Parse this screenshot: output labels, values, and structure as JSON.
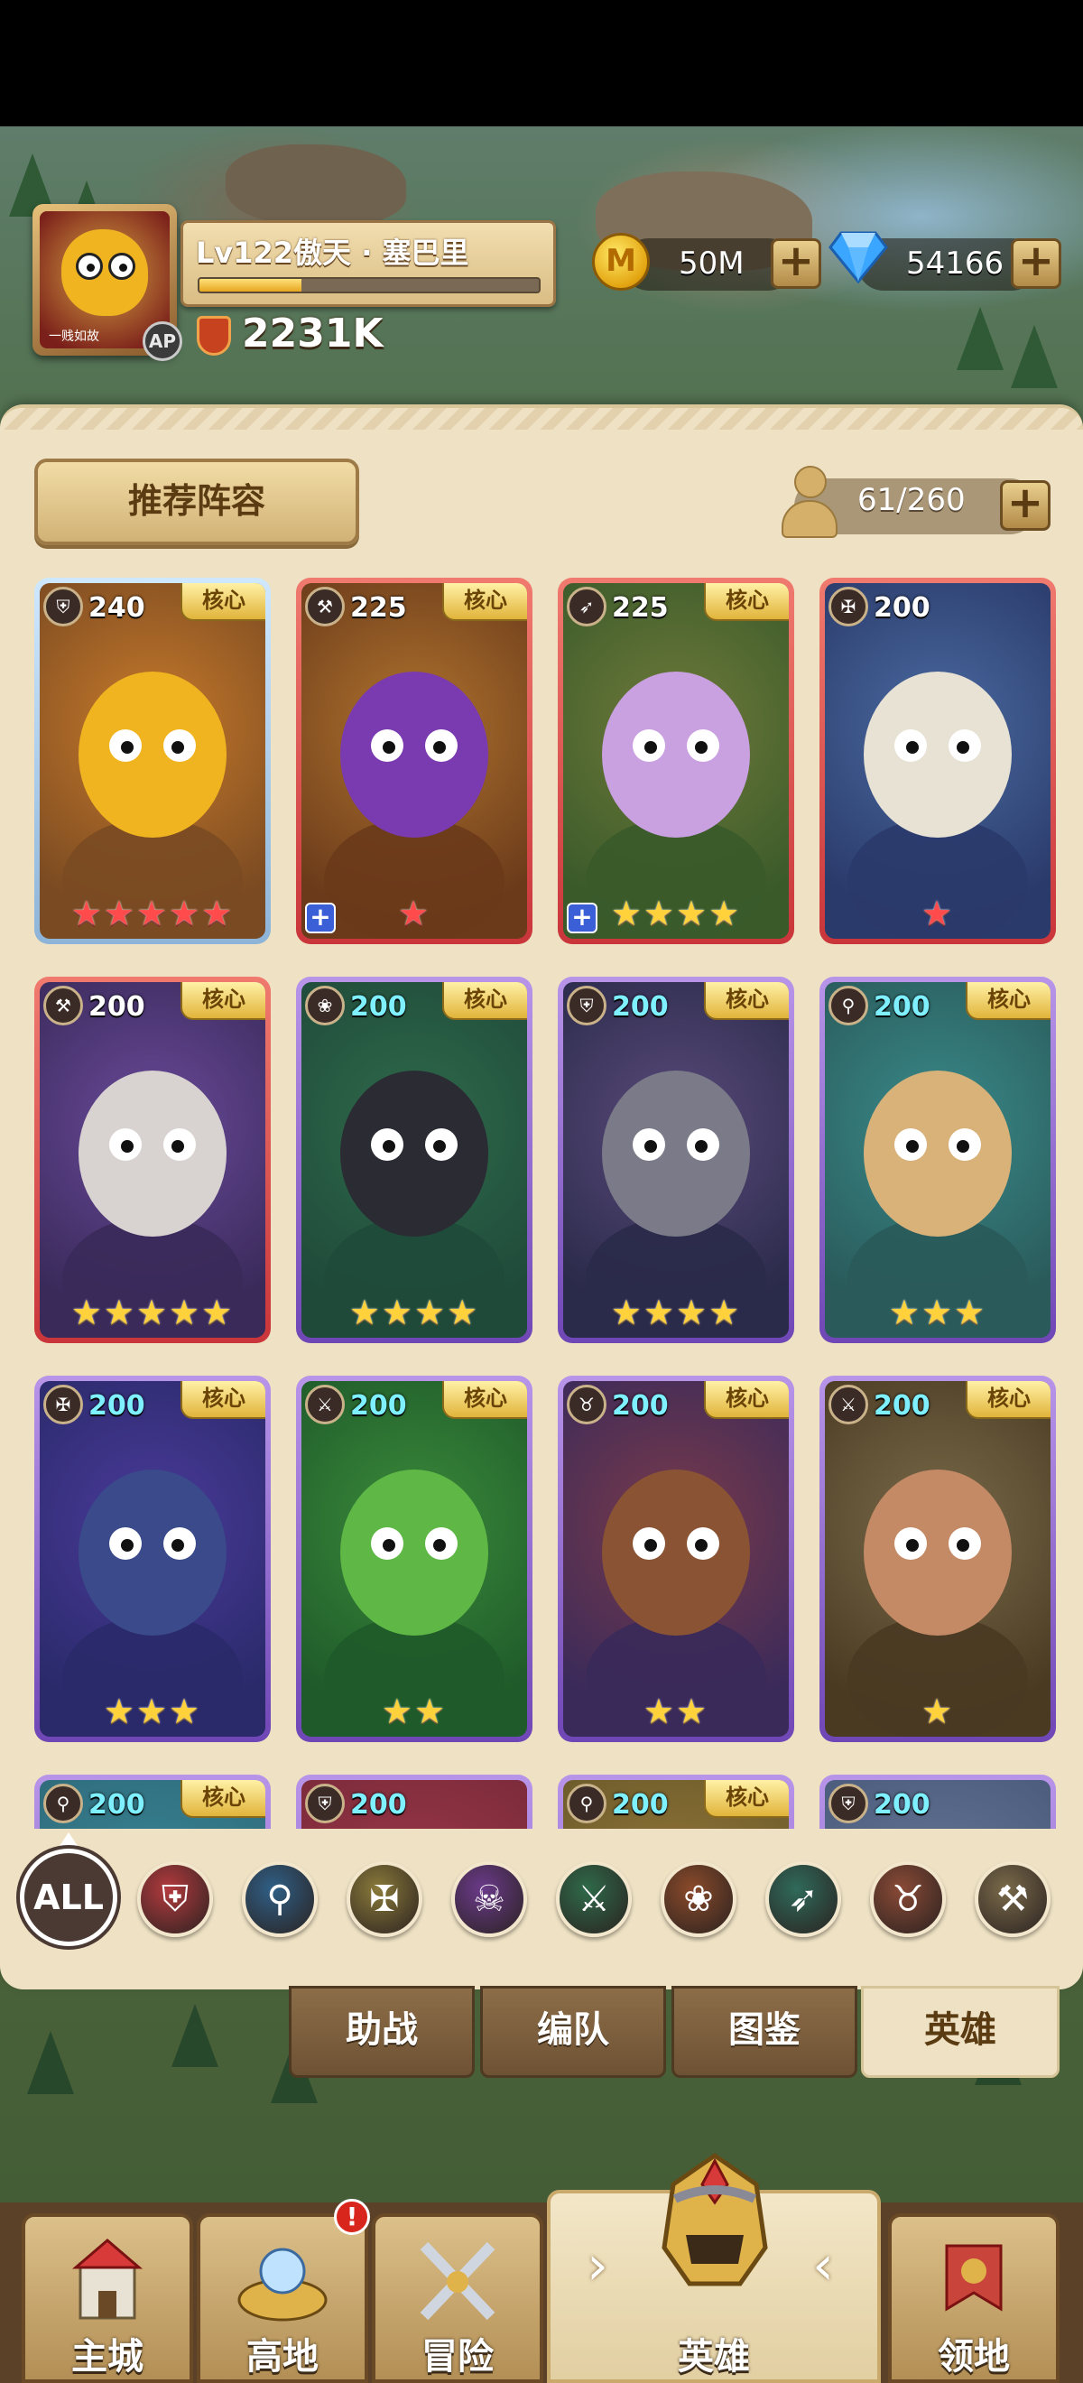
{
  "player": {
    "avatar_tag": "一贱如故",
    "badge": "AP",
    "name": "Lv122傲天 · 塞巴里",
    "xp_fraction": 0.3,
    "power": "2231K"
  },
  "currency": {
    "gold": "50M",
    "gold_coin_letter": "M",
    "gems": "54166",
    "plus": "+"
  },
  "panel": {
    "recommend_button": "推荐阵容",
    "capacity": "61/260",
    "capacity_plus": "+"
  },
  "heroes": [
    {
      "level": "240",
      "core": "核心",
      "frame": "blue",
      "class_icon": "shield-icon",
      "stars": 5,
      "star_color": "red",
      "plus": false,
      "level_color": "white",
      "portrait": "yellow-blob"
    },
    {
      "level": "225",
      "core": "核心",
      "frame": "red",
      "class_icon": "axe-icon",
      "stars": 1,
      "star_color": "red",
      "plus": true,
      "level_color": "white",
      "portrait": "elf-girl-brown"
    },
    {
      "level": "225",
      "core": "核心",
      "frame": "red",
      "class_icon": "bow-icon",
      "stars": 4,
      "star_color": "gold",
      "plus": true,
      "level_color": "white",
      "portrait": "elf-queen-green"
    },
    {
      "level": "200",
      "core": "",
      "frame": "red",
      "class_icon": "holy-icon",
      "stars": 1,
      "star_color": "red",
      "plus": false,
      "level_color": "white",
      "portrait": "blue-hair-girl"
    },
    {
      "level": "200",
      "core": "核心",
      "frame": "red",
      "class_icon": "hammer-icon",
      "stars": 5,
      "star_color": "gold",
      "plus": false,
      "level_color": "white",
      "portrait": "silver-hair-warrior"
    },
    {
      "level": "200",
      "core": "核心",
      "frame": "purple",
      "class_icon": "paw-icon",
      "stars": 4,
      "star_color": "gold",
      "plus": false,
      "level_color": "cyan",
      "portrait": "dark-dragon"
    },
    {
      "level": "200",
      "core": "核心",
      "frame": "purple",
      "class_icon": "shield-icon",
      "stars": 4,
      "star_color": "gold",
      "plus": false,
      "level_color": "cyan",
      "portrait": "horned-knight"
    },
    {
      "level": "200",
      "core": "核心",
      "frame": "purple",
      "class_icon": "staff-icon",
      "stars": 3,
      "star_color": "gold",
      "plus": false,
      "level_color": "cyan",
      "portrait": "elf-blonde"
    },
    {
      "level": "200",
      "core": "核心",
      "frame": "purple",
      "class_icon": "holy-icon",
      "stars": 3,
      "star_color": "gold",
      "plus": false,
      "level_color": "cyan",
      "portrait": "witch"
    },
    {
      "level": "200",
      "core": "核心",
      "frame": "purple",
      "class_icon": "blade-icon",
      "stars": 2,
      "star_color": "gold",
      "plus": false,
      "level_color": "cyan",
      "portrait": "green-orc"
    },
    {
      "level": "200",
      "core": "核心",
      "frame": "purple",
      "class_icon": "beast-icon",
      "stars": 2,
      "star_color": "gold",
      "plus": false,
      "level_color": "cyan",
      "portrait": "wolf-warrior"
    },
    {
      "level": "200",
      "core": "核心",
      "frame": "purple",
      "class_icon": "blade-icon",
      "stars": 1,
      "star_color": "gold",
      "plus": false,
      "level_color": "cyan",
      "portrait": "masked-assassin"
    },
    {
      "level": "200",
      "core": "核心",
      "frame": "purple",
      "class_icon": "staff-icon",
      "stars": 0,
      "star_color": "gold",
      "plus": false,
      "level_color": "cyan",
      "portrait": "teal"
    },
    {
      "level": "200",
      "core": "",
      "frame": "purple",
      "class_icon": "shield-icon",
      "stars": 0,
      "star_color": "gold",
      "plus": false,
      "level_color": "cyan",
      "portrait": "crimson"
    },
    {
      "level": "200",
      "core": "核心",
      "frame": "purple",
      "class_icon": "staff-icon",
      "stars": 0,
      "star_color": "gold",
      "plus": false,
      "level_color": "cyan",
      "portrait": "amber"
    },
    {
      "level": "200",
      "core": "",
      "frame": "purple",
      "class_icon": "shield-icon",
      "stars": 0,
      "star_color": "gold",
      "plus": false,
      "level_color": "cyan",
      "portrait": "slate"
    }
  ],
  "filters": {
    "all_label": "ALL",
    "items": [
      {
        "name": "shield-icon",
        "color": "#b33a3e",
        "glyph": "⛨"
      },
      {
        "name": "staff-icon",
        "color": "#2f5f86",
        "glyph": "⚲"
      },
      {
        "name": "holy-icon",
        "color": "#8a7a3a",
        "glyph": "✠"
      },
      {
        "name": "skull-icon",
        "color": "#6a3a8a",
        "glyph": "☠"
      },
      {
        "name": "blade-icon",
        "color": "#2f6a4a",
        "glyph": "⚔"
      },
      {
        "name": "paw-icon",
        "color": "#8a4a2a",
        "glyph": "❀"
      },
      {
        "name": "bow-icon",
        "color": "#2f6a5a",
        "glyph": "➶"
      },
      {
        "name": "beast-icon",
        "color": "#8a4a36",
        "glyph": "♉"
      },
      {
        "name": "hammer-icon",
        "color": "#7a6a4a",
        "glyph": "⚒"
      }
    ]
  },
  "tabs": [
    {
      "label": "助战",
      "active": false
    },
    {
      "label": "编队",
      "active": false
    },
    {
      "label": "图鉴",
      "active": false
    },
    {
      "label": "英雄",
      "active": true
    }
  ],
  "nav": [
    {
      "label": "主城",
      "icon": "castle-icon",
      "active": false
    },
    {
      "label": "高地",
      "icon": "highland-icon",
      "active": false
    },
    {
      "label": "冒险",
      "icon": "swords-icon",
      "active": false
    },
    {
      "label": "英雄",
      "icon": "helmet-icon",
      "active": true
    },
    {
      "label": "领地",
      "icon": "banner-icon",
      "active": false
    }
  ],
  "nav_alert": "!",
  "nav_arrows": {
    "left": "‹",
    "right": "›"
  },
  "colors": {
    "panel": "#efe2c4",
    "gold": "#ffd23c",
    "red_star": "#ff4b4b",
    "cyan_level": "#7ff0ff"
  }
}
